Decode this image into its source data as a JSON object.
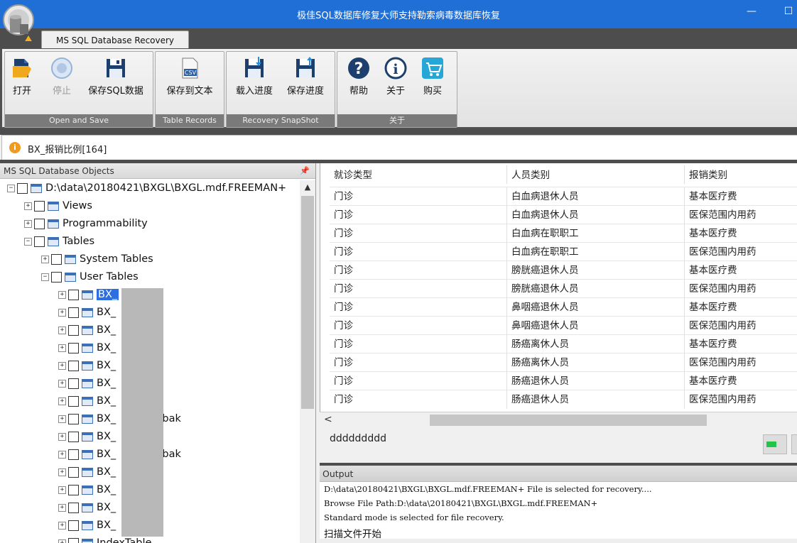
{
  "window": {
    "title": "极佳SQL数据库修复大师支持勒索病毒数据库恢复",
    "minimize": "—",
    "maximize": "☐"
  },
  "ribbon": {
    "tab": "MS SQL Database Recovery",
    "groups": {
      "open_save": "Open and Save",
      "table_records": "Table Records",
      "snapshot": "Recovery SnapShot",
      "about": "关于"
    },
    "buttons": {
      "open": "打开",
      "stop": "停止",
      "save_sql": "保存SQL数据",
      "save_text": "保存到文本",
      "load_progress": "载入进度",
      "save_progress": "保存进度",
      "help": "帮助",
      "about": "关于",
      "buy": "购买"
    },
    "csv_label": "CSV"
  },
  "infobar": {
    "icon": "i",
    "text": "BX_报销比例[164]"
  },
  "objects_panel": {
    "title": "MS SQL Database Objects",
    "pin": "ᵖ",
    "root": "D:\\data\\20180421\\BXGL\\BXGL.mdf.FREEMAN+",
    "views": "Views",
    "programmability": "Programmability",
    "tables": "Tables",
    "system_tables": "System Tables",
    "user_tables": "User Tables",
    "table_items": [
      "BX_",
      "BX_",
      "BX_",
      "BX_",
      "BX_",
      "BX_",
      "BX_",
      "BX_",
      "BX_",
      "BX_",
      "BX_",
      "BX_",
      "BX_",
      "BX_"
    ],
    "table_suffixes": [
      "",
      "",
      "",
      "",
      "",
      "",
      "",
      "_bak",
      "",
      "_bak",
      "",
      "",
      "",
      ""
    ],
    "last_item": "IndexTable"
  },
  "grid": {
    "columns": [
      "就诊类型",
      "人员类别",
      "报销类别"
    ],
    "rows": [
      [
        "门诊",
        "白血病退休人员",
        "基本医疗费"
      ],
      [
        "门诊",
        "白血病退休人员",
        "医保范围内用药"
      ],
      [
        "门诊",
        "白血病在职职工",
        "基本医疗费"
      ],
      [
        "门诊",
        "白血病在职职工",
        "医保范围内用药"
      ],
      [
        "门诊",
        "膀胱癌退休人员",
        "基本医疗费"
      ],
      [
        "门诊",
        "膀胱癌退休人员",
        "医保范围内用药"
      ],
      [
        "门诊",
        "鼻咽癌退休人员",
        "基本医疗费"
      ],
      [
        "门诊",
        "鼻咽癌退休人员",
        "医保范围内用药"
      ],
      [
        "门诊",
        "肠癌离休人员",
        "基本医疗费"
      ],
      [
        "门诊",
        "肠癌离休人员",
        "医保范围内用药"
      ],
      [
        "门诊",
        "肠癌退休人员",
        "基本医疗费"
      ],
      [
        "门诊",
        "肠癌退休人员",
        "医保范围内用药"
      ]
    ],
    "scroll_left": "<"
  },
  "status": {
    "text": "ddddddddd"
  },
  "output": {
    "title": "Output",
    "lines": [
      "D:\\data\\20180421\\BXGL\\BXGL.mdf.FREEMAN+ File is selected for recovery....",
      "Browse File Path:D:\\data\\20180421\\BXGL\\BXGL.mdf.FREEMAN+",
      "Standard mode is selected for file recovery.",
      "扫描文件开始"
    ]
  },
  "colors": {
    "titlebar": "#1f6fd6",
    "selection": "#2b6fe0",
    "progress": "#23c447"
  }
}
